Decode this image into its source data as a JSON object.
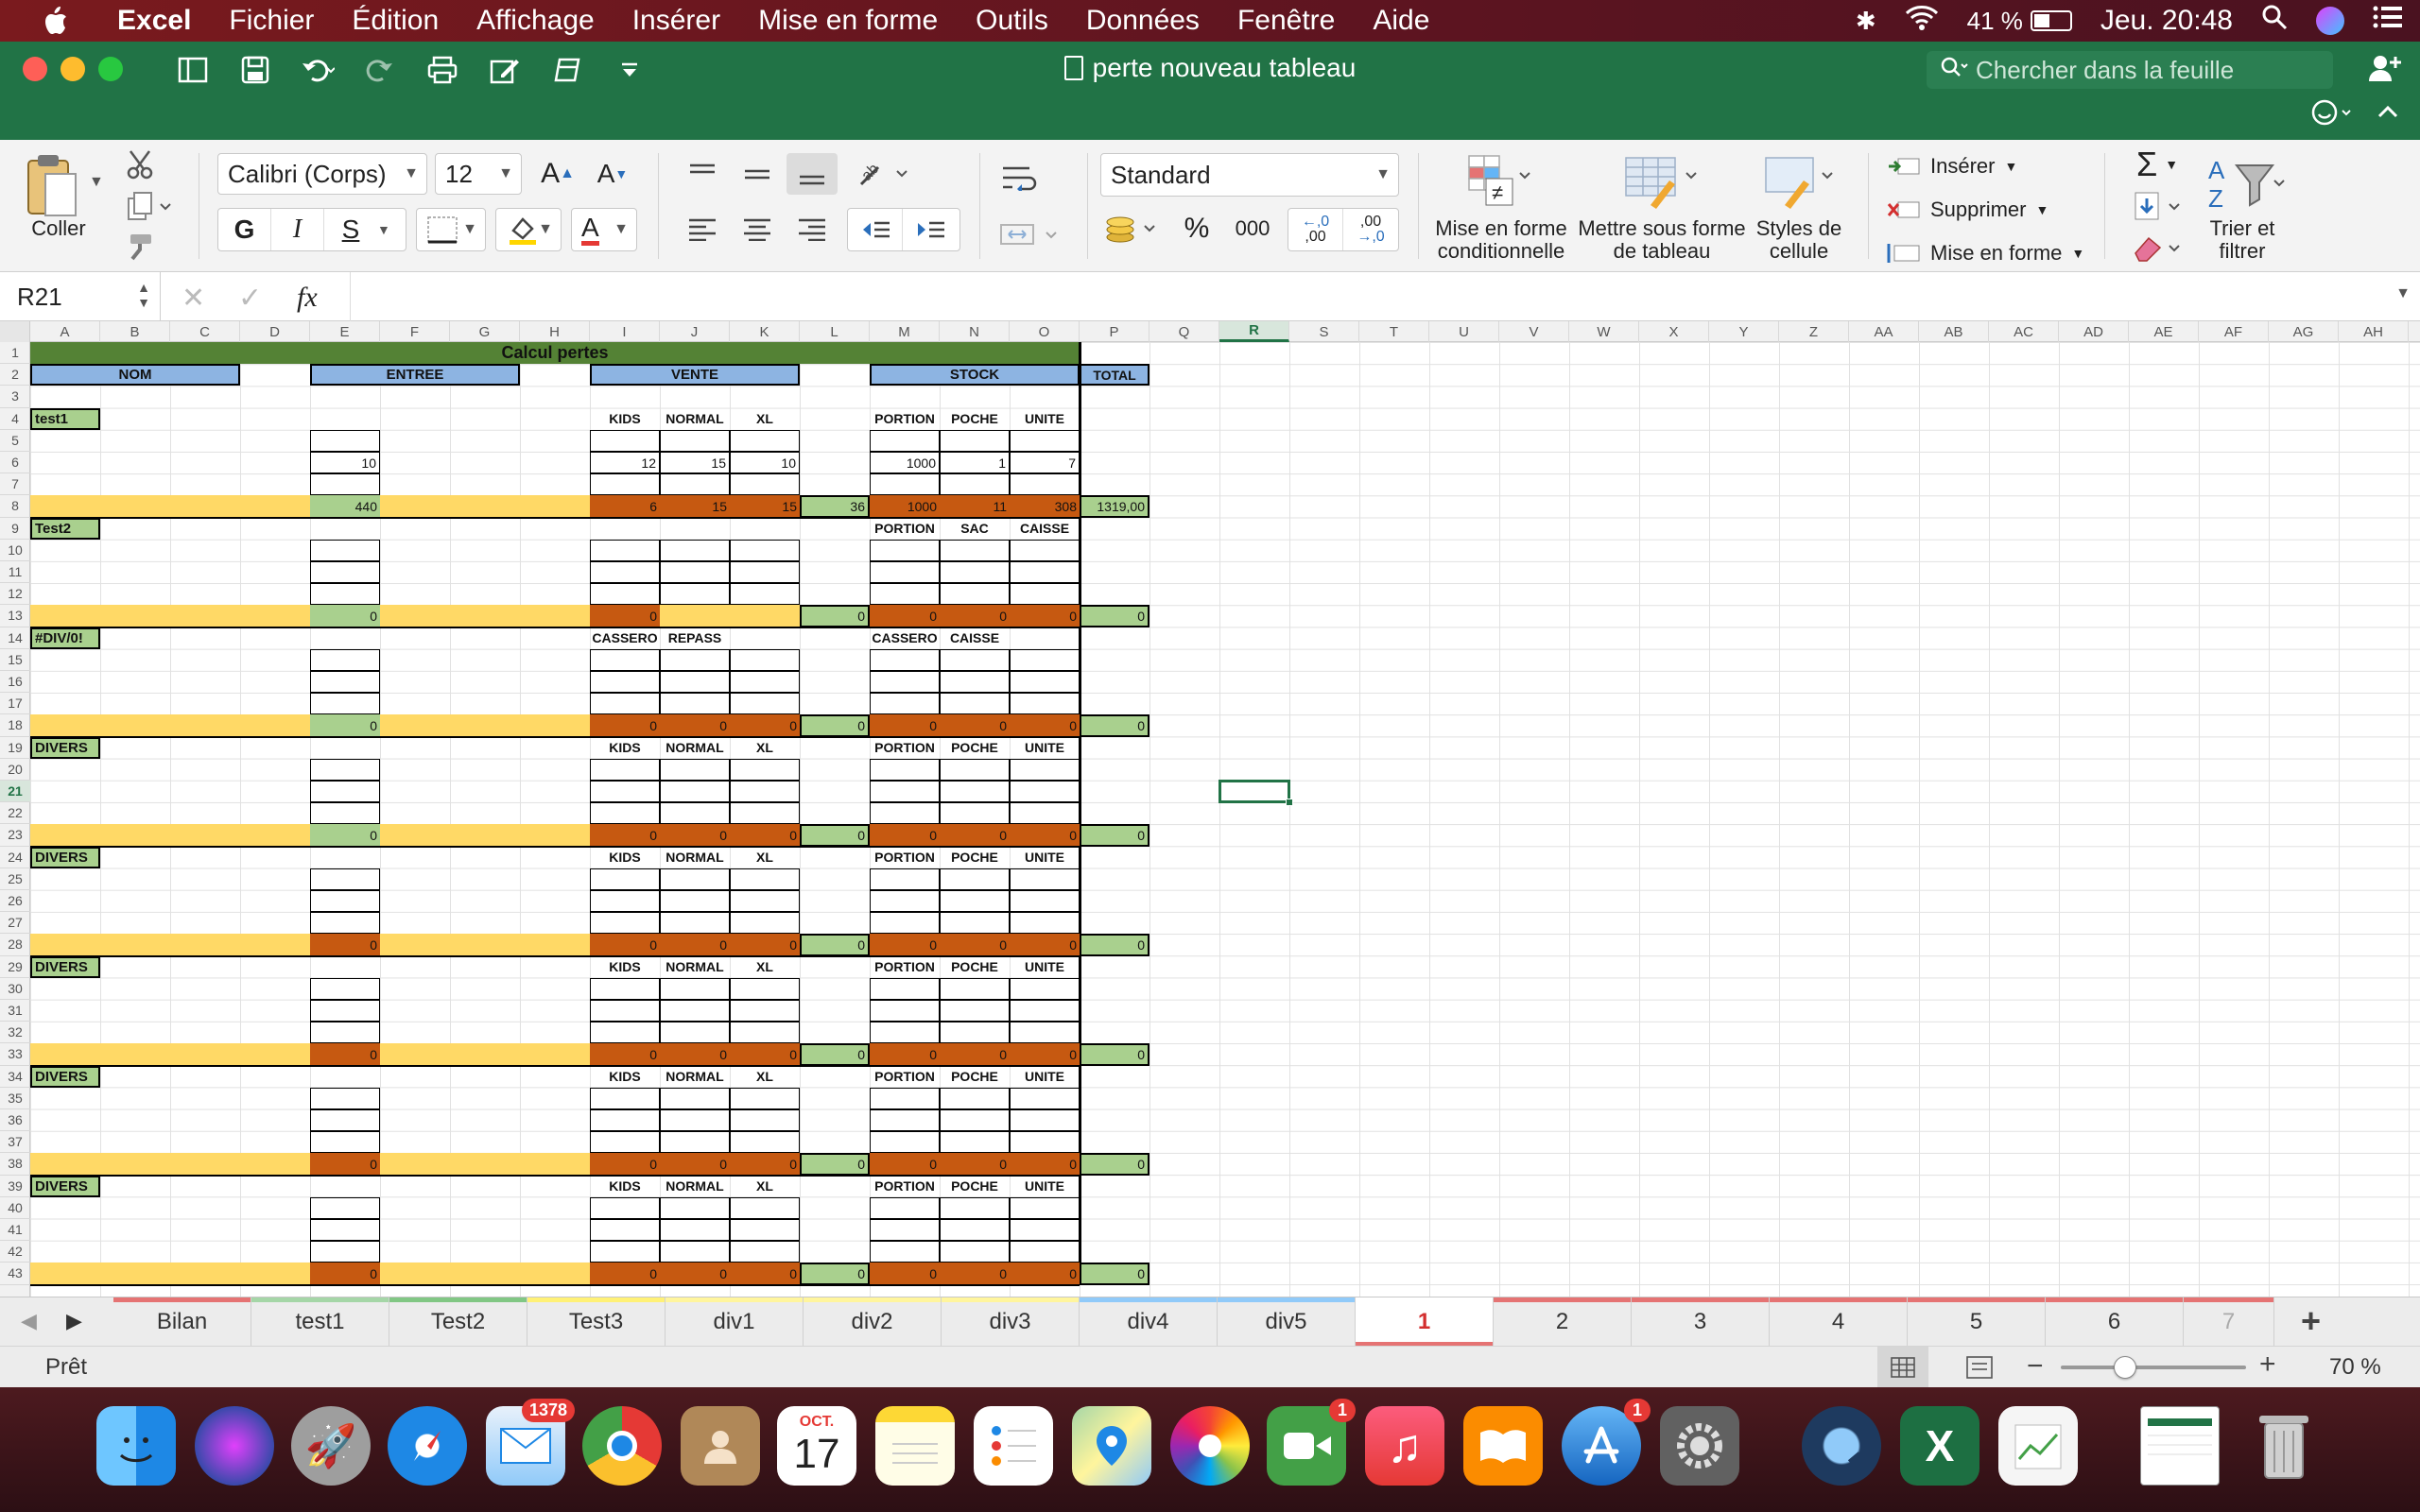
{
  "menubar": {
    "app": "Excel",
    "items": [
      "Fichier",
      "Édition",
      "Affichage",
      "Insérer",
      "Mise en forme",
      "Outils",
      "Données",
      "Fenêtre",
      "Aide"
    ],
    "battery": "41 %",
    "clock": "Jeu. 20:48"
  },
  "window": {
    "title": "perte nouveau tableau",
    "search_placeholder": "Chercher dans la feuille"
  },
  "ribbon": {
    "paste_label": "Coller",
    "font_name": "Calibri (Corps)",
    "font_size": "12",
    "bold": "G",
    "italic": "I",
    "underline": "S",
    "number_format": "Standard",
    "percent": "%",
    "thousands": "000",
    "cond_format_label": "Mise en forme conditionnelle",
    "table_format_label": "Mettre sous forme de tableau",
    "cell_styles_label": "Styles de cellule",
    "insert_label": "Insérer",
    "delete_label": "Supprimer",
    "format_label": "Mise en forme",
    "sort_label": "Trier et filtrer"
  },
  "formula_bar": {
    "name_box": "R21",
    "fx": "fx",
    "formula": ""
  },
  "grid": {
    "active_cell": "R21",
    "columns": [
      "A",
      "B",
      "C",
      "D",
      "E",
      "F",
      "G",
      "H",
      "I",
      "J",
      "K",
      "L",
      "M",
      "N",
      "O",
      "P",
      "Q",
      "R",
      "S",
      "T",
      "U",
      "V",
      "W",
      "X",
      "Y",
      "Z",
      "AA",
      "AB",
      "AC",
      "AD",
      "AE",
      "AF",
      "AG",
      "AH"
    ],
    "row_count": 43,
    "title": "Calcul pertes",
    "headers": {
      "nom": "NOM",
      "entree": "ENTREE",
      "vente": "VENTE",
      "stock": "STOCK",
      "total": "TOTAL"
    },
    "sections": [
      {
        "name": "test1",
        "row": 4,
        "sub_vente": [
          "KIDS",
          "NORMAL",
          "XL"
        ],
        "sub_stock": [
          "PORTION",
          "POCHE",
          "UNITE"
        ],
        "data_row": {
          "entree": "10",
          "vente": [
            "12",
            "15",
            "10"
          ],
          "stock": [
            "1000",
            "1",
            "7"
          ]
        },
        "totals": {
          "entree": "440",
          "vente": [
            "6",
            "15",
            "15"
          ],
          "l": "36",
          "stock": [
            "1000",
            "11",
            "308"
          ],
          "total": "1319,00"
        }
      },
      {
        "name": "Test2",
        "row": 9,
        "sub_vente": [
          "",
          "",
          ""
        ],
        "sub_stock": [
          "PORTION",
          "SAC",
          "CAISSE"
        ],
        "totals": {
          "entree": "0",
          "vente": [
            "0",
            "",
            ""
          ],
          "l": "0",
          "stock": [
            "0",
            "0",
            "0"
          ],
          "total": "0"
        }
      },
      {
        "name": "#DIV/0!",
        "row": 14,
        "sub_vente": [
          "CASSERO",
          "REPASS",
          ""
        ],
        "sub_stock": [
          "CASSERO",
          "CAISSE",
          ""
        ],
        "totals": {
          "entree": "0",
          "vente": [
            "0",
            "0",
            "0"
          ],
          "l": "0",
          "stock": [
            "0",
            "0",
            "0"
          ],
          "total": "0"
        }
      },
      {
        "name": "DIVERS",
        "row": 19,
        "sub_vente": [
          "KIDS",
          "NORMAL",
          "XL"
        ],
        "sub_stock": [
          "PORTION",
          "POCHE",
          "UNITE"
        ],
        "totals": {
          "entree": "0",
          "vente": [
            "0",
            "0",
            "0"
          ],
          "l": "0",
          "stock": [
            "0",
            "0",
            "0"
          ],
          "total": "0"
        }
      },
      {
        "name": "DIVERS",
        "row": 24,
        "sub_vente": [
          "KIDS",
          "NORMAL",
          "XL"
        ],
        "sub_stock": [
          "PORTION",
          "POCHE",
          "UNITE"
        ],
        "totals": {
          "entree": "0",
          "vente": [
            "0",
            "0",
            "0"
          ],
          "l": "0",
          "stock": [
            "0",
            "0",
            "0"
          ],
          "total": "0"
        }
      },
      {
        "name": "DIVERS",
        "row": 29,
        "sub_vente": [
          "KIDS",
          "NORMAL",
          "XL"
        ],
        "sub_stock": [
          "PORTION",
          "POCHE",
          "UNITE"
        ],
        "totals": {
          "entree": "0",
          "vente": [
            "0",
            "0",
            "0"
          ],
          "l": "0",
          "stock": [
            "0",
            "0",
            "0"
          ],
          "total": "0"
        }
      },
      {
        "name": "DIVERS",
        "row": 34,
        "sub_vente": [
          "KIDS",
          "NORMAL",
          "XL"
        ],
        "sub_stock": [
          "PORTION",
          "POCHE",
          "UNITE"
        ],
        "totals": {
          "entree": "0",
          "vente": [
            "0",
            "0",
            "0"
          ],
          "l": "0",
          "stock": [
            "0",
            "0",
            "0"
          ],
          "total": "0"
        }
      },
      {
        "name": "DIVERS",
        "row": 39,
        "sub_vente": [
          "KIDS",
          "NORMAL",
          "XL"
        ],
        "sub_stock": [
          "PORTION",
          "POCHE",
          "UNITE"
        ],
        "totals": {
          "entree": "0",
          "vente": [
            "0",
            "0",
            "0"
          ],
          "l": "0",
          "stock": [
            "0",
            "0",
            "0"
          ],
          "total": "0"
        }
      }
    ],
    "colors": {
      "green_dark": "#548235",
      "blue": "#8db4e2",
      "green_light": "#a9d08e",
      "yellow": "#ffd966",
      "orange": "#c65911",
      "section_label": "#a9d08e"
    }
  },
  "sheet_tabs": [
    {
      "label": "Bilan",
      "color": "#e57373"
    },
    {
      "label": "test1",
      "color": "#a5d6a7"
    },
    {
      "label": "Test2",
      "color": "#81c784"
    },
    {
      "label": "Test3",
      "color": "#fff176"
    },
    {
      "label": "div1",
      "color": "#fff59d"
    },
    {
      "label": "div2",
      "color": "#fff59d"
    },
    {
      "label": "div3",
      "color": "#fff59d"
    },
    {
      "label": "div4",
      "color": "#90caf9"
    },
    {
      "label": "div5",
      "color": "#90caf9"
    },
    {
      "label": "1",
      "color": "#e57373",
      "active": true
    },
    {
      "label": "2",
      "color": "#e57373"
    },
    {
      "label": "3",
      "color": "#e57373"
    },
    {
      "label": "4",
      "color": "#e57373"
    },
    {
      "label": "5",
      "color": "#e57373"
    },
    {
      "label": "6",
      "color": "#e57373"
    },
    {
      "label": "7",
      "color": "#e57373"
    }
  ],
  "status": {
    "text": "Prêt",
    "zoom": "70 %"
  },
  "dock": {
    "icons": [
      "finder",
      "siri",
      "launchpad",
      "safari",
      "mail",
      "chrome",
      "contacts",
      "calendar",
      "notes",
      "reminders",
      "maps",
      "photos",
      "facetime",
      "music",
      "books",
      "app-store",
      "system-preferences",
      "quicktime",
      "excel",
      "preview",
      "screenshot",
      "trash"
    ],
    "mail_badge": "1378",
    "facetime_badge": "1",
    "appstore_badge": "1",
    "calendar_month": "OCT.",
    "calendar_day": "17"
  }
}
